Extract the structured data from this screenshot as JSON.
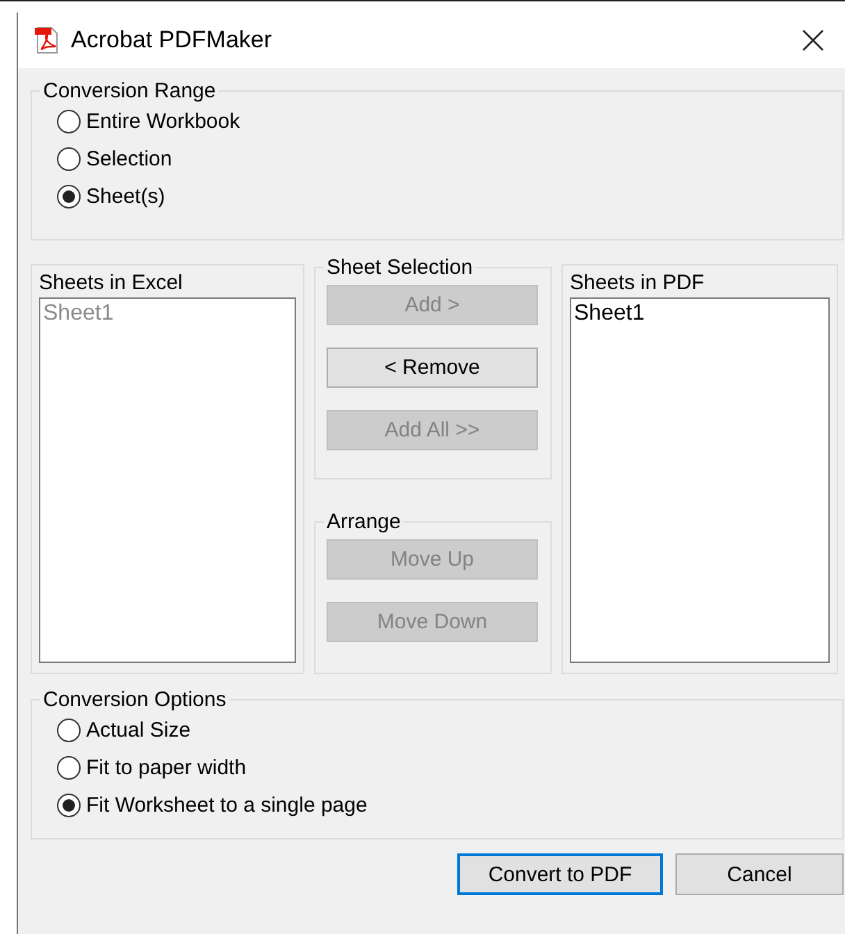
{
  "window": {
    "title": "Acrobat PDFMaker"
  },
  "conversion_range": {
    "label": "Conversion Range",
    "options": [
      {
        "label": "Entire Workbook",
        "selected": false
      },
      {
        "label": "Selection",
        "selected": false
      },
      {
        "label": "Sheet(s)",
        "selected": true
      }
    ]
  },
  "sheets_in_excel": {
    "label": "Sheets in Excel",
    "disabled": true,
    "items": [
      "Sheet1"
    ]
  },
  "sheet_selection": {
    "label": "Sheet Selection",
    "buttons": [
      {
        "label": "Add >",
        "disabled": true
      },
      {
        "label": "< Remove",
        "disabled": false
      },
      {
        "label": "Add All >>",
        "disabled": true
      }
    ]
  },
  "arrange": {
    "label": "Arrange",
    "buttons": [
      {
        "label": "Move Up",
        "disabled": true
      },
      {
        "label": "Move Down",
        "disabled": true
      }
    ]
  },
  "sheets_in_pdf": {
    "label": "Sheets in PDF",
    "disabled": false,
    "items": [
      "Sheet1"
    ]
  },
  "conversion_options": {
    "label": "Conversion Options",
    "options": [
      {
        "label": "Actual Size",
        "selected": false
      },
      {
        "label": "Fit to paper width",
        "selected": false
      },
      {
        "label": "Fit Worksheet to a single page",
        "selected": true
      }
    ]
  },
  "buttons": [
    {
      "label": "Convert to PDF",
      "default": true
    },
    {
      "label": "Cancel",
      "default": false
    }
  ]
}
